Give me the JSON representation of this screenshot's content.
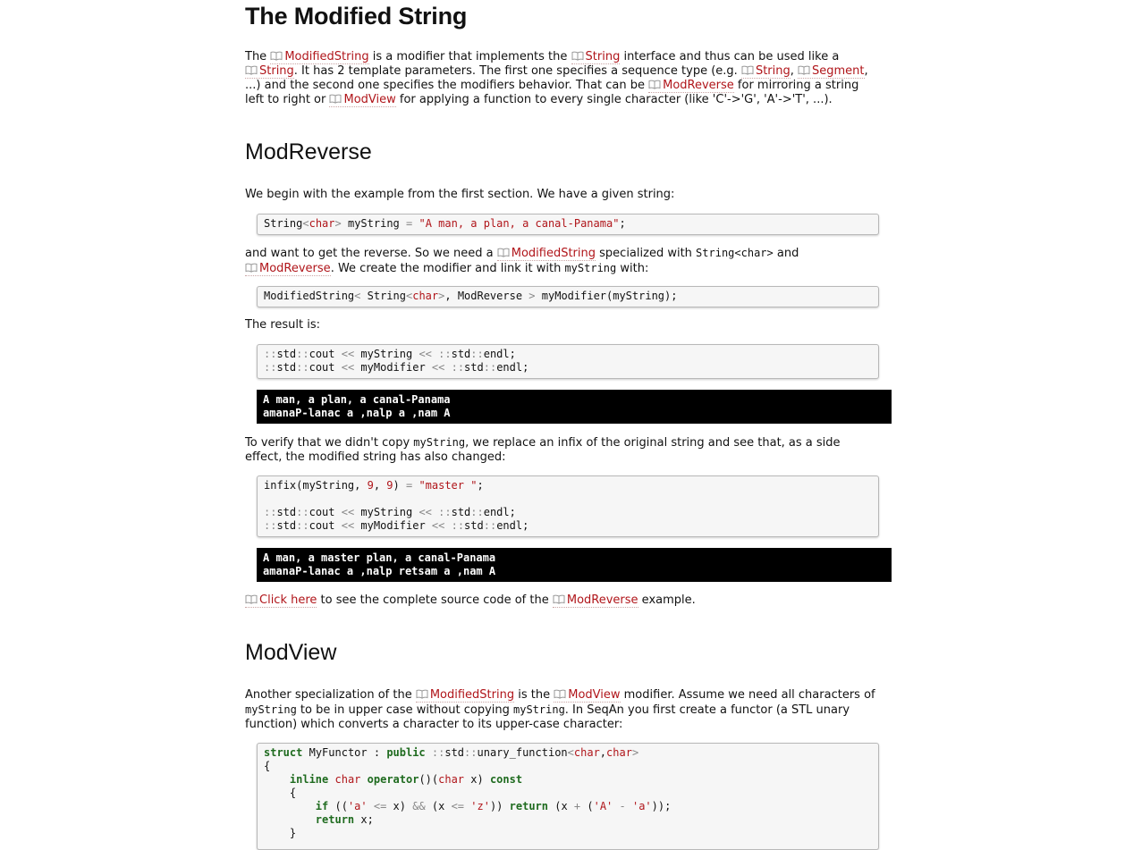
{
  "title": "The Modified String",
  "intro": {
    "t1": "The ",
    "l_modstring": "ModifiedString",
    "t2": " is a modifier that implements the ",
    "l_string": "String",
    "t3": " interface and thus can be used like a",
    "l_string2": "String",
    "t4": ". It has 2 template parameters. The first one specifies a sequence type (e.g. ",
    "l_string3": "String",
    "t5": ", ",
    "l_segment": "Segment",
    "t6": ",",
    "t7": "...) and the second one specifies the modifiers behavior. That can be ",
    "l_modreverse": "ModReverse",
    "t8": " for mirroring a string",
    "t9": "left to right or ",
    "l_modview": "ModView",
    "t10": " for applying a function to every single character (like 'C'->'G', 'A'->'T', ...)."
  },
  "section_reverse": {
    "heading": "ModReverse",
    "p1": "We begin with the example from the first section. We have a given string:",
    "code1": {
      "a": "String",
      "b": "char",
      "c": "myString",
      "d": "\"A man, a plan, a canal-Panama\""
    },
    "p2": {
      "t1": "and want to get the reverse. So we need a ",
      "l_modstring": "ModifiedString",
      "t2": " specialized with ",
      "c1": "String<char>",
      "t3": " and",
      "l_modreverse": "ModReverse",
      "t4": ". We create the modifier and link it with ",
      "c2": "myString",
      "t5": " with:"
    },
    "code2": {
      "a": "ModifiedString",
      "b": "String",
      "c": "char",
      "d": "ModReverse",
      "e": "myModifier(myString);"
    },
    "p3": "The result is:",
    "code3": {
      "l1a": "std",
      "l1b": "cout",
      "l1c": "myString",
      "l1d": "std",
      "l1e": "endl;",
      "l2a": "std",
      "l2b": "cout",
      "l2c": "myModifier",
      "l2d": "std",
      "l2e": "endl;"
    },
    "out1": [
      "A man, a plan, a canal-Panama",
      "amanaP-lanac a ,nalp a ,nam A"
    ],
    "p4": {
      "t1": "To verify that we didn't copy ",
      "c1": "myString",
      "t2": ", we replace an infix of the original string and see that, as a side",
      "t3": "effect, the modified string has also changed:"
    },
    "code4": {
      "a": "infix(myString, ",
      "b": "9",
      "c": "9",
      "d": "\"master \"",
      "l3a": "std",
      "l3b": "cout",
      "l3c": "myString",
      "l3d": "std",
      "l3e": "endl;",
      "l4a": "std",
      "l4b": "cout",
      "l4c": "myModifier",
      "l4d": "std",
      "l4e": "endl;"
    },
    "out2": [
      "A man, a master plan, a canal-Panama",
      "amanaP-lanac a ,nalp retsam a ,nam A"
    ],
    "p5": {
      "l_click": "Click here",
      "t1": " to see the complete source code of the ",
      "l_modreverse": "ModReverse",
      "t2": " example."
    }
  },
  "section_view": {
    "heading": "ModView",
    "p1": {
      "t1": "Another specialization of the ",
      "l_modstring": "ModifiedString",
      "t2": " is the ",
      "l_modview": "ModView",
      "t3": " modifier. Assume we need all characters of",
      "c1": "myString",
      "t4": " to be in upper case without copying ",
      "c2": "myString",
      "t5": ". In SeqAn you first create a functor (a STL unary",
      "t6": "function) which converts a character to its upper-case character:"
    },
    "code5": {
      "kw_struct": "struct",
      "name": "MyFunctor",
      "kw_public": "public",
      "uf": "std",
      "uf2": "unary_function",
      "ty1": "char",
      "ty2": "char",
      "kw_inline": "inline",
      "ty3": "char",
      "kw_operator": "operator",
      "paren": "()(",
      "ty4": "char",
      "x": " x) ",
      "kw_const": "const",
      "kw_if": "if",
      "s_a": "'a'",
      "s_z": "'z'",
      "kw_return": "return",
      "s_A": "'A'",
      "s_a2": "'a'",
      "kw_return2": "return",
      "ret_x": " x;"
    }
  }
}
